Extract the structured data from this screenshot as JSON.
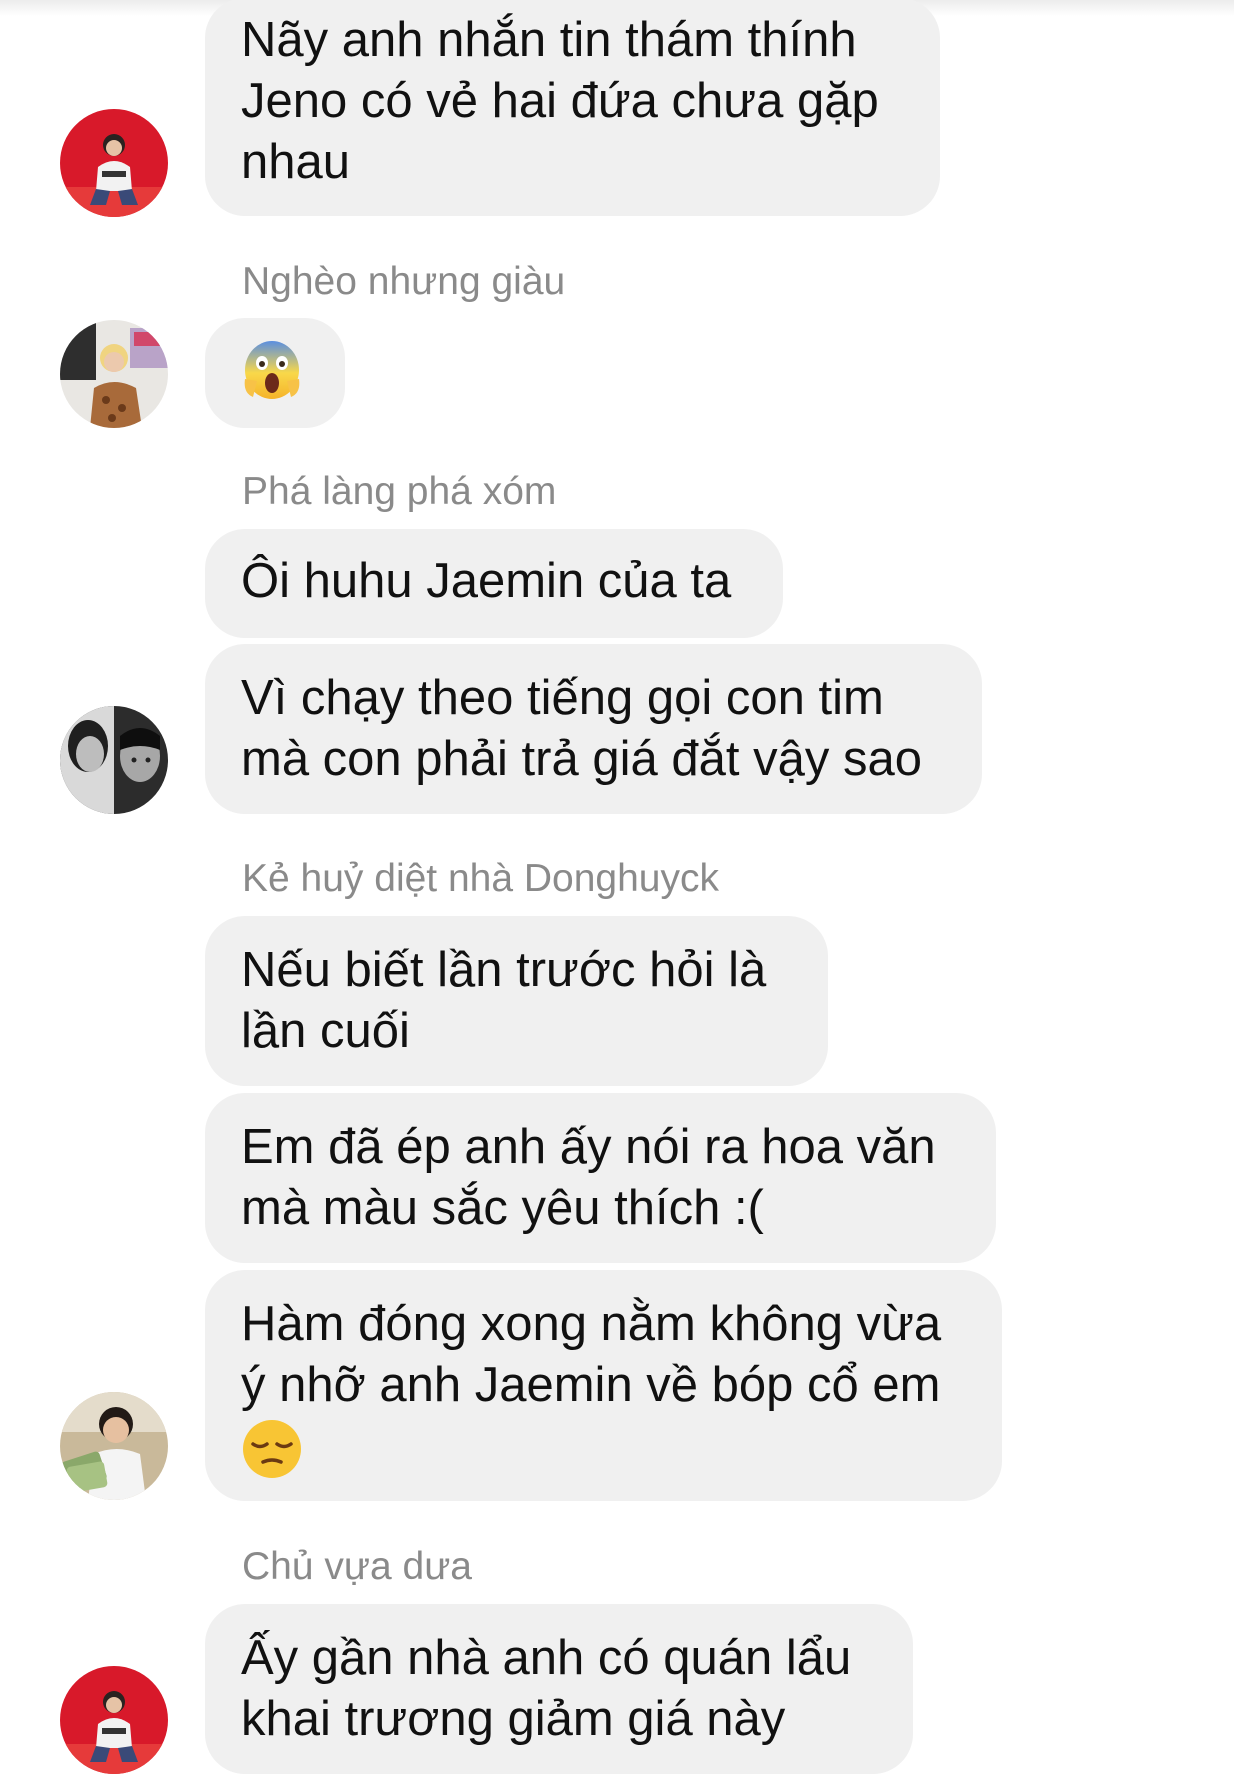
{
  "messages": [
    {
      "lines": [
        "Nãy anh nhắn tin thám thính",
        "Jeno có vẻ hai đứa chưa gặp",
        "nhau"
      ]
    },
    {
      "sender": "Nghèo nhưng giàu",
      "emoji": "face-screaming-in-fear-emoji"
    },
    {
      "sender": "Phá làng phá xóm",
      "lines": [
        "Ôi huhu Jaemin của ta"
      ]
    },
    {
      "lines": [
        "Vì chạy theo tiếng gọi con tim",
        "mà con phải trả giá đắt vậy sao"
      ]
    },
    {
      "sender": "Kẻ huỷ diệt nhà Donghuyck",
      "lines": [
        "Nếu biết lần trước hỏi là",
        "lần cuối"
      ]
    },
    {
      "lines": [
        "Em đã ép anh ấy nói ra hoa văn",
        "mà màu sắc yêu thích :("
      ]
    },
    {
      "lines": [
        "Hàm đóng xong nằm không vừa",
        "ý nhỡ anh Jaemin về bóp cổ em"
      ],
      "emoji": "pensive-face-emoji"
    },
    {
      "sender": "Chủ vựa dưa",
      "lines": [
        "Ấy gần nhà anh có quán lẩu",
        "khai trương giảm giá này"
      ]
    }
  ],
  "avatars": [
    {
      "icon": "avatar-red-background-person"
    },
    {
      "icon": "avatar-person-patterned-shirt"
    },
    {
      "icon": "avatar-grayscale-portrait"
    },
    {
      "icon": "avatar-boy-holding-money"
    },
    {
      "icon": "avatar-red-background-person"
    }
  ],
  "colors": {
    "bubble": "#f0f0f0",
    "text": "#111111",
    "sender": "#8a8a8a",
    "background": "#ffffff"
  }
}
